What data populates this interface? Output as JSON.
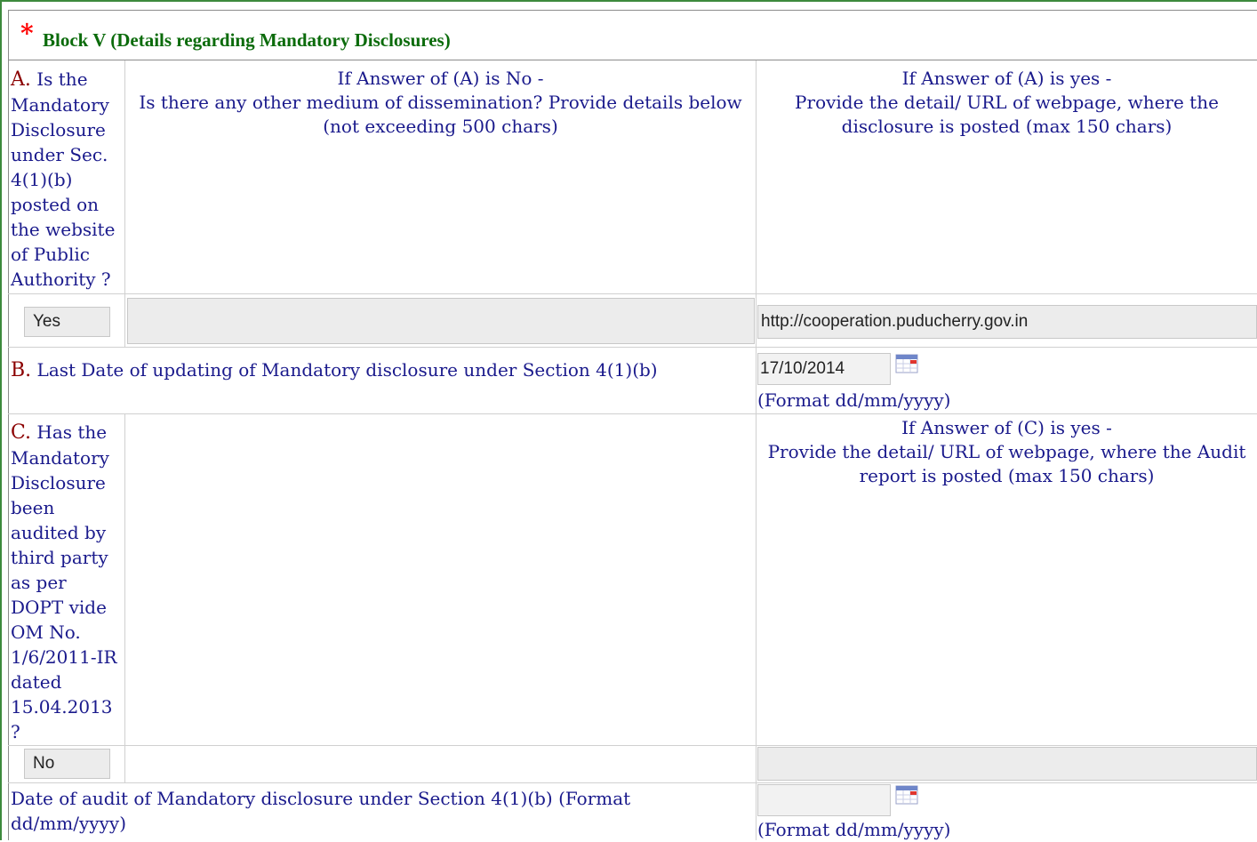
{
  "header": {
    "marker": "*",
    "title": "Block V (Details regarding Mandatory Disclosures)"
  },
  "sectionA": {
    "letter": "A.",
    "question_lines": [
      "Is the",
      "Mandatory",
      "Disclosure",
      "under Sec.",
      "4(1)(b)",
      "posted on",
      "the website",
      "of Public",
      "Authority ?"
    ],
    "no_header_lines": [
      "If Answer of (A) is No -",
      "Is there any other medium of dissemination? Provide details below",
      "(not exceeding 500 chars)"
    ],
    "yes_header_lines": [
      "If Answer of (A) is yes -",
      "Provide the detail/ URL of webpage, where the",
      "disclosure is posted (max 150 chars)"
    ],
    "answer": "Yes",
    "other_medium_value": "",
    "url_value": "http://cooperation.puducherry.gov.in"
  },
  "sectionB": {
    "letter": "B.",
    "label": "Last Date of updating of Mandatory disclosure under Section 4(1)(b)",
    "date_value": "17/10/2014",
    "format_hint": "(Format dd/mm/yyyy)"
  },
  "sectionC": {
    "letter": "C.",
    "question_lines": [
      "Has the",
      "Mandatory",
      "Disclosure",
      "been",
      "audited by",
      "third party",
      "as per",
      "DOPT vide",
      "OM No.",
      "1/6/2011-IR",
      "dated",
      "15.04.2013",
      "?"
    ],
    "yes_header_lines": [
      "If Answer of (C) is yes -",
      "Provide the detail/ URL of webpage, where the Audit",
      "report is posted (max 150 chars)"
    ],
    "answer": "No",
    "url_value": ""
  },
  "audit_date": {
    "label_lines": [
      "Date of audit of Mandatory disclosure under Section 4(1)(b) (Format",
      "dd/mm/yyyy)"
    ],
    "date_value": "",
    "format_hint": "(Format dd/mm/yyyy)"
  },
  "colors": {
    "text": "#1a1a8c",
    "letter": "#8b0000",
    "title": "#0b6b0b",
    "marker": "#ff0000",
    "frame": "#3d8a3d"
  }
}
